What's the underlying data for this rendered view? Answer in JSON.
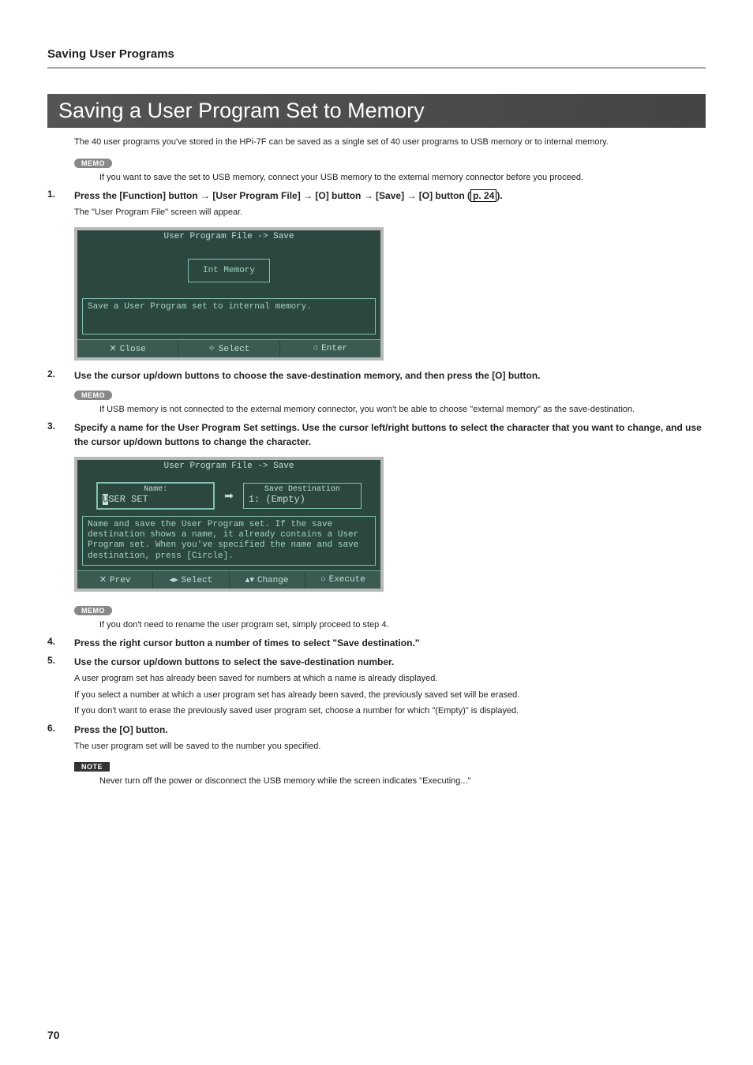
{
  "section_title": "Saving User Programs",
  "main_heading": "Saving a User Program Set to Memory",
  "intro": "The 40 user programs you've stored in the HPi-7F can be saved as a single set of 40 user programs to USB memory or to internal memory.",
  "memo_label": "MEMO",
  "note_label": "NOTE",
  "memo1": "If you want to save the set to USB memory, connect your USB memory to the external memory connector before you proceed.",
  "step1_num": "1.",
  "step1_prefix": "Press the [Function] button ",
  "step1_a": "[User Program File]",
  "step1_b": "[O] button",
  "step1_c": "[Save]",
  "step1_d": "[O] button (",
  "step1_pref": "p. 24",
  "step1_suffix": ").",
  "step1_sub": "The \"User Program File\" screen will appear.",
  "ss1": {
    "title": "User Program File -> Save",
    "int_memory": "Int Memory",
    "desc": "Save a User Program set to internal memory.",
    "close": "Close",
    "select": "Select",
    "enter": "Enter"
  },
  "step2_num": "2.",
  "step2": "Use the cursor up/down buttons to choose the save-destination memory, and then press the [O] button.",
  "memo2": "If USB memory is not connected to the external memory connector, you won't be able to choose \"external memory\" as the save-destination.",
  "step3_num": "3.",
  "step3": "Specify a name for the User Program Set settings. Use the cursor left/right buttons to select the character that you want to change, and use the cursor up/down buttons to change the character.",
  "ss2": {
    "title": "User Program File -> Save",
    "name_label": "Name:",
    "name_val_hl": "U",
    "name_val_rest": "SER SET",
    "dest_label": "Save Destination",
    "dest_val": "1: (Empty)",
    "desc": "Name and save the User Program set. If the save destination shows a name, it already contains a User Program set. When you've specified the name and save destination, press [Circle].",
    "prev": "Prev",
    "select": "Select",
    "change": "Change",
    "execute": "Execute"
  },
  "memo3": "If you don't need to rename the user program set, simply proceed to step 4.",
  "step4_num": "4.",
  "step4": "Press the right cursor button a number of times to select \"Save destination.\"",
  "step5_num": "5.",
  "step5": "Use the cursor up/down buttons to select the save-destination number.",
  "step5_sub1": "A user program set has already been saved for numbers at which a name is already displayed.",
  "step5_sub2": "If you select a number at which a user program set has already been saved, the previously saved set will be erased.",
  "step5_sub3": "If you don't want to erase the previously saved user program set, choose a number for which \"(Empty)\" is displayed.",
  "step6_num": "6.",
  "step6": "Press the [O] button.",
  "step6_sub": "The user program set will be saved to the number you specified.",
  "note1": "Never turn off the power or disconnect the USB memory while the screen indicates \"Executing...\"",
  "page_number": "70"
}
